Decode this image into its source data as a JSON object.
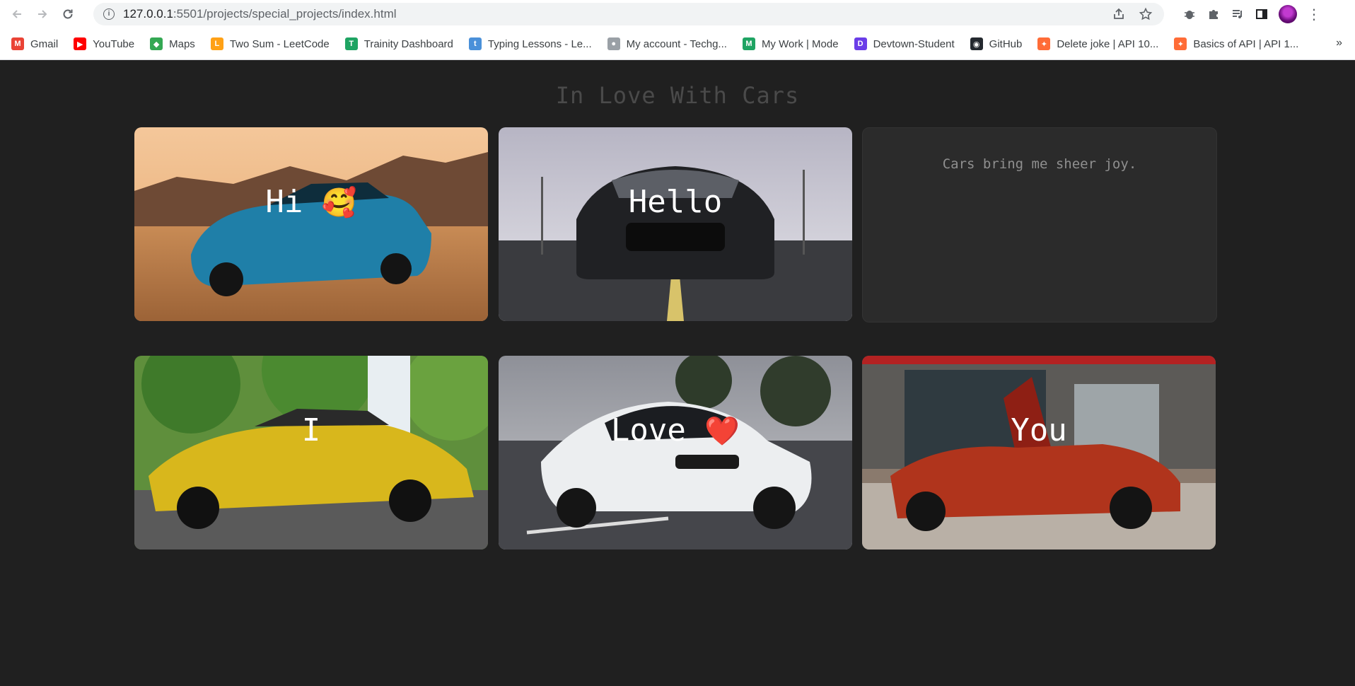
{
  "browser": {
    "url_host": "127.0.0.1",
    "url_rest": ":5501/projects/special_projects/index.html",
    "bookmarks": [
      {
        "label": "Gmail",
        "icon": "gmail-icon",
        "color": "#ea4335"
      },
      {
        "label": "YouTube",
        "icon": "youtube-icon",
        "color": "#ff0000"
      },
      {
        "label": "Maps",
        "icon": "maps-icon",
        "color": "#34a853"
      },
      {
        "label": "Two Sum - LeetCode",
        "icon": "leetcode-icon",
        "color": "#ffa116"
      },
      {
        "label": "Trainity Dashboard",
        "icon": "trainity-icon",
        "color": "#1fa463"
      },
      {
        "label": "Typing Lessons - Le...",
        "icon": "typing-icon",
        "color": "#4a90d9"
      },
      {
        "label": "My account - Techg...",
        "icon": "techgig-icon",
        "color": "#9aa0a6"
      },
      {
        "label": "My Work | Mode",
        "icon": "mode-icon",
        "color": "#1fa463"
      },
      {
        "label": "Devtown-Student",
        "icon": "devtown-icon",
        "color": "#6a3de8"
      },
      {
        "label": "GitHub",
        "icon": "github-icon",
        "color": "#24292f"
      },
      {
        "label": "Delete joke | API 10...",
        "icon": "postman-icon",
        "color": "#ff6c37"
      },
      {
        "label": "Basics of API | API 1...",
        "icon": "postman-icon",
        "color": "#ff6c37"
      }
    ],
    "more_label": "»"
  },
  "page": {
    "title": "In Love With Cars",
    "cards": [
      {
        "label": "Hi",
        "emoji": "🥰"
      },
      {
        "label": "Hello",
        "emoji": ""
      },
      {
        "text": "Cars bring me sheer joy."
      },
      {
        "label": "I",
        "emoji": ""
      },
      {
        "label": "Love",
        "emoji": "❤️"
      },
      {
        "label": "You",
        "emoji": ""
      }
    ]
  }
}
